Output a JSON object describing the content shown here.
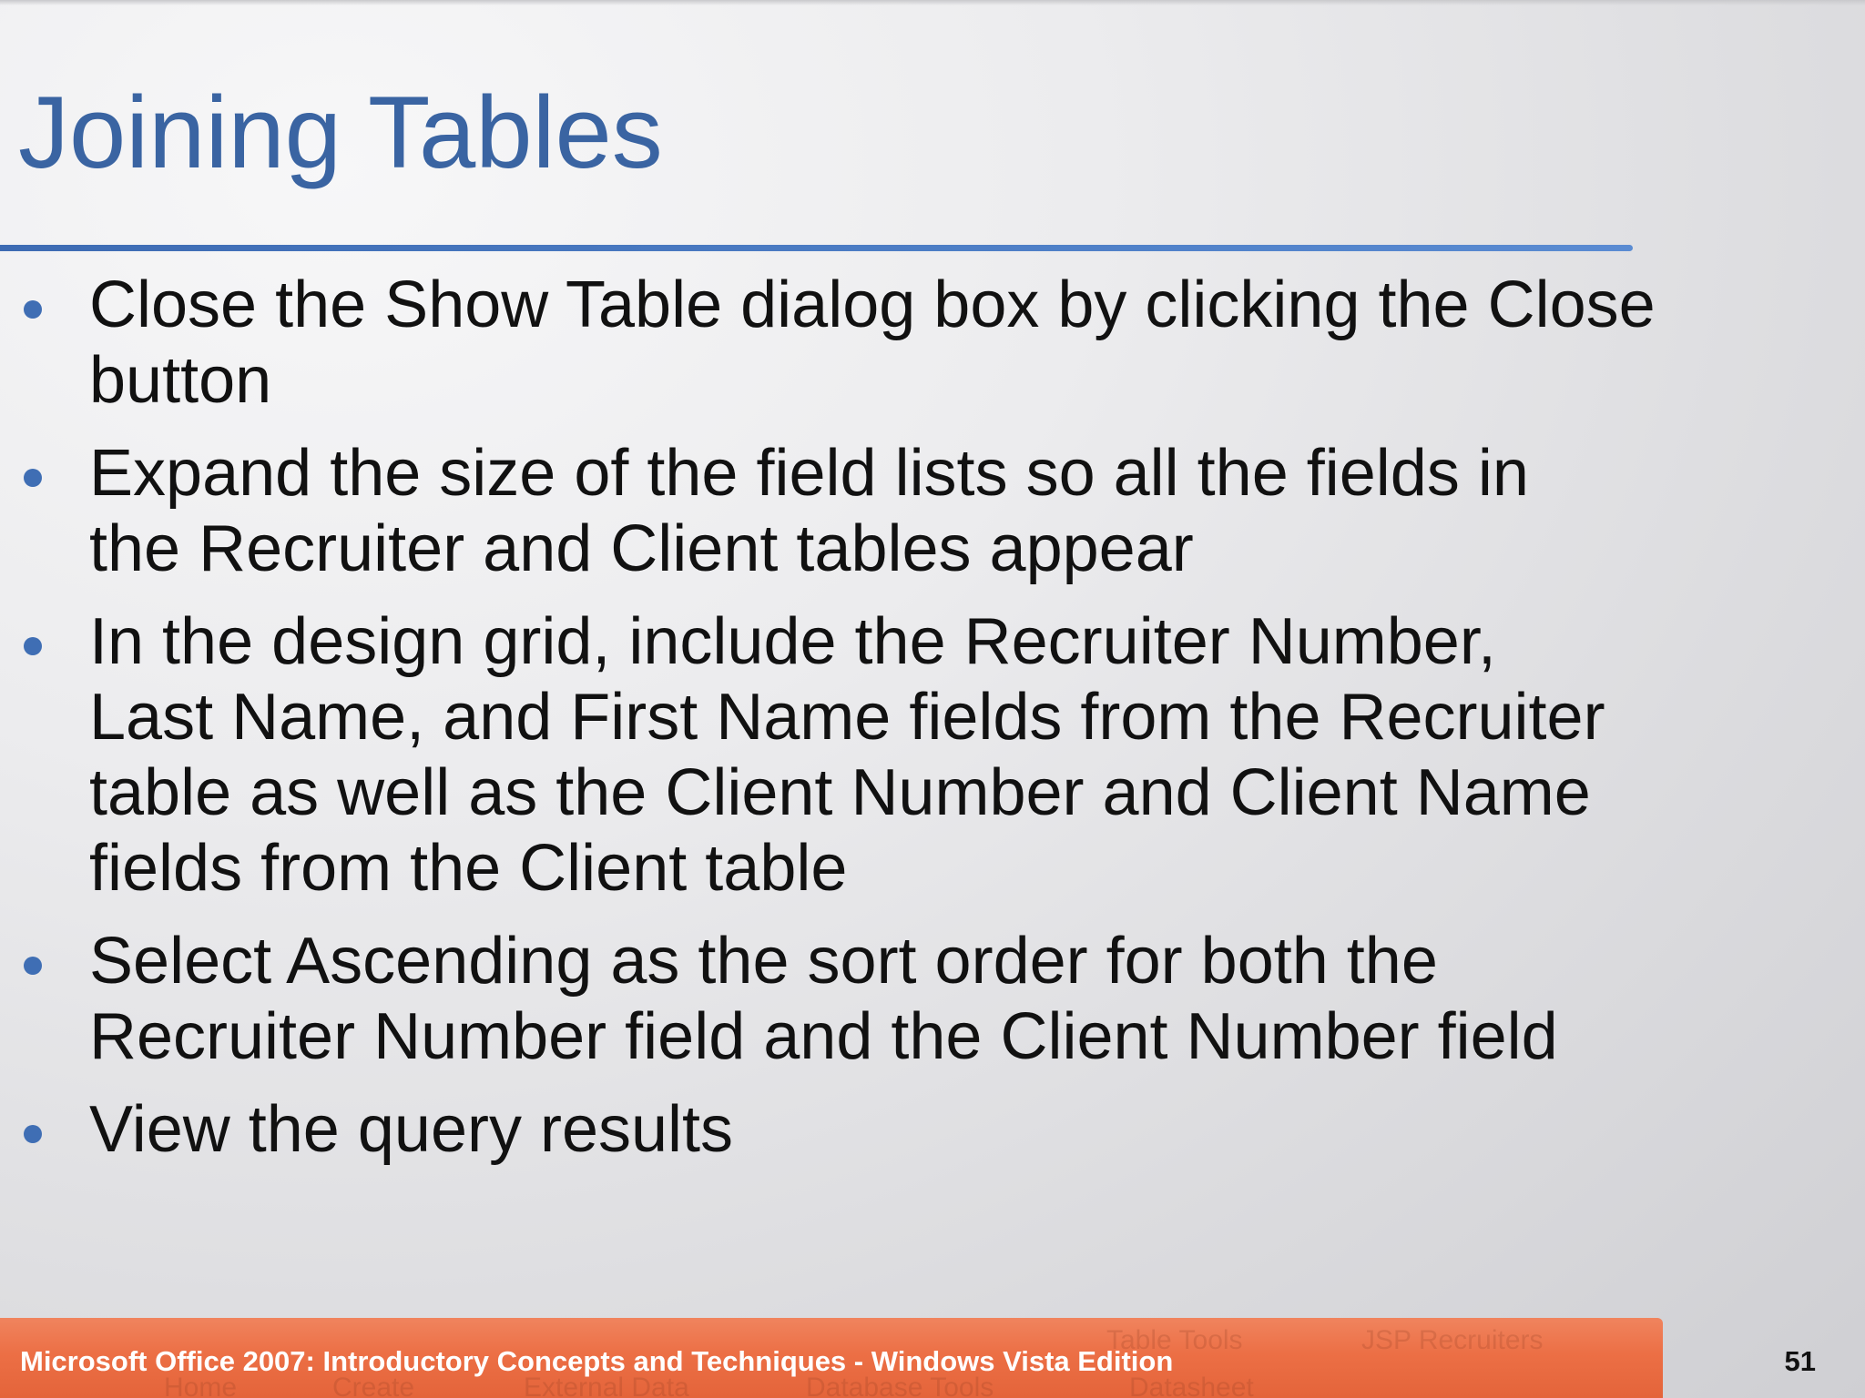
{
  "slide": {
    "title": "Joining Tables",
    "bullets": [
      {
        "lines": [
          "Close the Show Table dialog box by clicking the Close",
          "button"
        ]
      },
      {
        "lines": [
          "Expand the size of the field lists so all the fields in",
          "the Recruiter and Client tables appear"
        ]
      },
      {
        "lines": [
          "In the design grid, include the Recruiter Number,",
          "Last Name, and First Name fields from the Recruiter",
          "table as well as the Client Number and Client Name",
          "fields from the Client table"
        ]
      },
      {
        "lines": [
          "Select Ascending as the sort order for both the",
          "Recruiter Number field and the Client Number field"
        ]
      },
      {
        "lines": [
          "View the query results"
        ]
      }
    ]
  },
  "footer": {
    "text": "Microsoft Office 2007: Introductory Concepts and Techniques - Windows Vista Edition",
    "page_number": "51",
    "background_ghost": {
      "table_tools": "Table Tools",
      "recruiters": "JSP Recruiters",
      "home": "Home",
      "create": "Create",
      "external_data": "External Data",
      "database_tools": "Database Tools",
      "datasheet": "Datasheet"
    }
  },
  "colors": {
    "title": "#3a64a2",
    "rule": "#4d7ec6",
    "bullet": "#3f6eb4",
    "body_text": "#111111",
    "footer_bar": "#ec6f45",
    "footer_text": "#ffffff"
  }
}
